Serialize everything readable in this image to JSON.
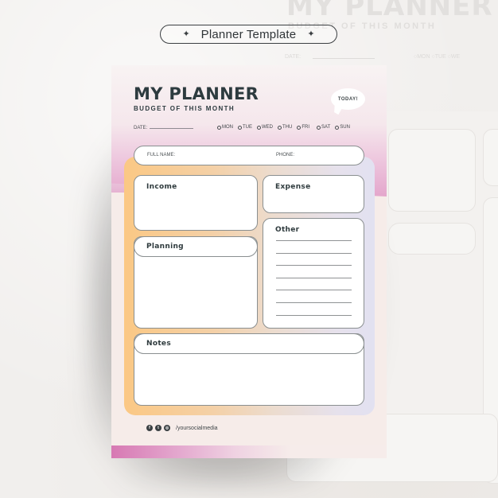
{
  "header_pill": {
    "label": "Planner Template",
    "left_icon": "sparkle-icon",
    "right_icon": "sparkle-icon"
  },
  "background_ghost": {
    "title": "MY PLANNER",
    "subtitle": "BUDGET OF THIS MONTH",
    "date_label": "DATE:",
    "days_text": "○MON  ○TUE  ○WE"
  },
  "planner": {
    "title": "MY PLANNER",
    "subtitle": "BUDGET OF THIS MONTH",
    "today_bubble": "TODAY!",
    "date_label": "DATE:",
    "days": [
      "MON",
      "TUE",
      "WED",
      "THU",
      "FRI",
      "SAT",
      "SUN"
    ],
    "full_name_label": "FULL NAME:",
    "phone_label": "PHONE:",
    "sections": {
      "income": "Income",
      "expense": "Expense",
      "planning": "Planning",
      "other": "Other",
      "notes": "Notes"
    },
    "other_line_count": 7,
    "social": {
      "icons": [
        "facebook-icon",
        "twitter-icon",
        "instagram-icon"
      ],
      "handle": "/yoursocialmedia"
    }
  },
  "colors": {
    "ink": "#2d3b3f",
    "pink_accent": "#d779b3",
    "orange_gradient_start": "#fbc884",
    "lavender_gradient_end": "#e2e1f1",
    "paper": "#f6ece9"
  }
}
